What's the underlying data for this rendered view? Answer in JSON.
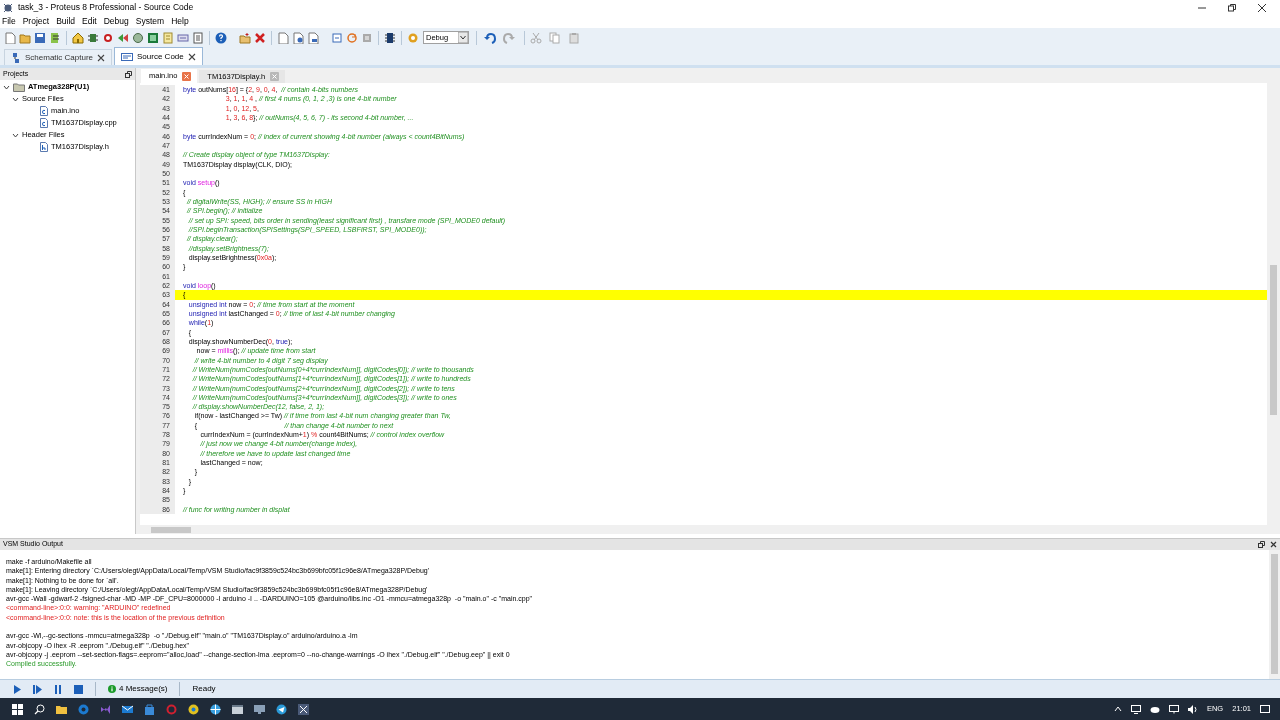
{
  "window": {
    "title": "task_3 - Proteus 8 Professional - Source Code"
  },
  "menu": [
    "File",
    "Project",
    "Build",
    "Edit",
    "Debug",
    "System",
    "Help"
  ],
  "toolbar": {
    "configuration": "Debug"
  },
  "tabs": [
    {
      "label": "Schematic Capture",
      "selected": false
    },
    {
      "label": "Source Code",
      "selected": true
    }
  ],
  "projects": {
    "title": "Projects",
    "tree": [
      {
        "label": "ATmega328P(U1)",
        "kind": "device",
        "expanded": true,
        "children": [
          {
            "label": "Source Files",
            "expanded": true,
            "children": [
              {
                "label": "main.ino",
                "kind": "source"
              },
              {
                "label": "TM1637Display.cpp",
                "kind": "source"
              }
            ]
          },
          {
            "label": "Header Files",
            "expanded": true,
            "children": [
              {
                "label": "TM1637Display.h",
                "kind": "header"
              }
            ]
          }
        ]
      }
    ]
  },
  "editor": {
    "tabs": [
      {
        "label": "main.ino",
        "selected": true
      },
      {
        "label": "TM1637Display.h",
        "selected": false
      }
    ],
    "lines": [
      {
        "number": "41",
        "current": false,
        "tokens": [
          {
            "kind": "keyword",
            "text": "byte"
          },
          {
            "kind": "plain",
            "text": " outNums["
          },
          {
            "kind": "number",
            "text": "16"
          },
          {
            "kind": "plain",
            "text": "] = {"
          },
          {
            "kind": "number",
            "text": "2"
          },
          {
            "kind": "plain",
            "text": ", "
          },
          {
            "kind": "number",
            "text": "9"
          },
          {
            "kind": "plain",
            "text": ", "
          },
          {
            "kind": "number",
            "text": "0"
          },
          {
            "kind": "plain",
            "text": ", "
          },
          {
            "kind": "number",
            "text": "4"
          },
          {
            "kind": "plain",
            "text": ",  "
          },
          {
            "kind": "comment",
            "text": "// contain 4-bits numbers"
          }
        ]
      },
      {
        "number": "42",
        "current": false,
        "tokens": [
          {
            "kind": "number",
            "text": "                      3"
          },
          {
            "kind": "plain",
            "text": ", "
          },
          {
            "kind": "number",
            "text": "1"
          },
          {
            "kind": "plain",
            "text": ", "
          },
          {
            "kind": "number",
            "text": "1"
          },
          {
            "kind": "plain",
            "text": ", "
          },
          {
            "kind": "number",
            "text": "4"
          },
          {
            "kind": "plain",
            "text": " , "
          },
          {
            "kind": "comment",
            "text": "// first 4 nums (0, 1, 2 ,3) is one 4-bit number"
          }
        ]
      },
      {
        "number": "43",
        "current": false,
        "tokens": [
          {
            "kind": "number",
            "text": "                      1"
          },
          {
            "kind": "plain",
            "text": ", "
          },
          {
            "kind": "number",
            "text": "0"
          },
          {
            "kind": "plain",
            "text": ", "
          },
          {
            "kind": "number",
            "text": "12"
          },
          {
            "kind": "plain",
            "text": ", "
          },
          {
            "kind": "number",
            "text": "5"
          },
          {
            "kind": "plain",
            "text": ","
          }
        ]
      },
      {
        "number": "44",
        "current": false,
        "tokens": [
          {
            "kind": "number",
            "text": "                      1"
          },
          {
            "kind": "plain",
            "text": ", "
          },
          {
            "kind": "number",
            "text": "3"
          },
          {
            "kind": "plain",
            "text": ", "
          },
          {
            "kind": "number",
            "text": "6"
          },
          {
            "kind": "plain",
            "text": ", "
          },
          {
            "kind": "number",
            "text": "8"
          },
          {
            "kind": "plain",
            "text": "}; "
          },
          {
            "kind": "comment",
            "text": "// outNums(4, 5, 6, 7) - its second 4-bit number, ..."
          }
        ]
      },
      {
        "number": "45",
        "current": false
      },
      {
        "number": "46",
        "current": false,
        "tokens": [
          {
            "kind": "keyword",
            "text": "byte"
          },
          {
            "kind": "plain",
            "text": " currIndexNum = "
          },
          {
            "kind": "number",
            "text": "0"
          },
          {
            "kind": "plain",
            "text": "; "
          },
          {
            "kind": "comment",
            "text": "// index of current showing 4-bit number (always < count4BitNums)"
          }
        ]
      },
      {
        "number": "47",
        "current": false
      },
      {
        "number": "48",
        "current": false,
        "tokens": [
          {
            "kind": "comment",
            "text": "// Create display object of type TM1637Display:"
          }
        ]
      },
      {
        "number": "49",
        "current": false,
        "tokens": [
          {
            "kind": "plain",
            "text": "TM1637Display display(CLK, DIO);"
          }
        ]
      },
      {
        "number": "50",
        "current": false
      },
      {
        "number": "51",
        "current": false,
        "tokens": [
          {
            "kind": "keyword",
            "text": "void "
          },
          {
            "kind": "function",
            "text": "setup"
          },
          {
            "kind": "plain",
            "text": "()"
          }
        ]
      },
      {
        "number": "52",
        "current": false,
        "tokens": [
          {
            "kind": "plain",
            "text": "{"
          }
        ]
      },
      {
        "number": "53",
        "current": false,
        "tokens": [
          {
            "kind": "comment",
            "text": "  // digitalWrite(SS, HIGH); // ensure SS in HIGH"
          }
        ]
      },
      {
        "number": "54",
        "current": false,
        "tokens": [
          {
            "kind": "comment",
            "text": "  // SPI.begin(); // initialize"
          }
        ]
      },
      {
        "number": "55",
        "current": false,
        "tokens": [
          {
            "kind": "comment",
            "text": "   // set up SPI: speed, bits order in sending(least significant first) , transfare mode (SPI_MODE0 default)"
          }
        ]
      },
      {
        "number": "56",
        "current": false,
        "tokens": [
          {
            "kind": "comment",
            "text": "   //SPI.beginTransaction(SPISettings(SPI_SPEED, LSBFIRST, SPI_MODE0));"
          }
        ]
      },
      {
        "number": "57",
        "current": false,
        "tokens": [
          {
            "kind": "comment",
            "text": "  // display.clear();"
          }
        ]
      },
      {
        "number": "58",
        "current": false,
        "tokens": [
          {
            "kind": "comment",
            "text": "   //display.setBrightness(7);"
          }
        ]
      },
      {
        "number": "59",
        "current": false,
        "tokens": [
          {
            "kind": "plain",
            "text": "   display.setBrightness("
          },
          {
            "kind": "number",
            "text": "0x0a"
          },
          {
            "kind": "plain",
            "text": ");"
          }
        ]
      },
      {
        "number": "60",
        "current": false,
        "tokens": [
          {
            "kind": "plain",
            "text": "}"
          }
        ]
      },
      {
        "number": "61",
        "current": false
      },
      {
        "number": "62",
        "current": false,
        "tokens": [
          {
            "kind": "keyword",
            "text": "void "
          },
          {
            "kind": "function",
            "text": "loop"
          },
          {
            "kind": "plain",
            "text": "()"
          }
        ]
      },
      {
        "number": "63",
        "current": true,
        "tokens": [
          {
            "kind": "plain",
            "text": "{"
          }
        ]
      },
      {
        "number": "64",
        "current": false,
        "tokens": [
          {
            "kind": "keyword",
            "text": "   unsigned int"
          },
          {
            "kind": "plain",
            "text": " now = "
          },
          {
            "kind": "number",
            "text": "0"
          },
          {
            "kind": "plain",
            "text": "; "
          },
          {
            "kind": "comment",
            "text": "// time from start at the moment"
          }
        ]
      },
      {
        "number": "65",
        "current": false,
        "tokens": [
          {
            "kind": "keyword",
            "text": "   unsigned int"
          },
          {
            "kind": "plain",
            "text": " lastChanged = "
          },
          {
            "kind": "number",
            "text": "0"
          },
          {
            "kind": "plain",
            "text": "; "
          },
          {
            "kind": "comment",
            "text": "// time of last 4-bit number changing"
          }
        ]
      },
      {
        "number": "66",
        "current": false,
        "tokens": [
          {
            "kind": "keyword",
            "text": "   while"
          },
          {
            "kind": "plain",
            "text": "("
          },
          {
            "kind": "number",
            "text": "1"
          },
          {
            "kind": "plain",
            "text": ")"
          }
        ]
      },
      {
        "number": "67",
        "current": false,
        "tokens": [
          {
            "kind": "plain",
            "text": "   {"
          }
        ]
      },
      {
        "number": "68",
        "current": false,
        "tokens": [
          {
            "kind": "plain",
            "text": "   display.showNumberDec("
          },
          {
            "kind": "number",
            "text": "0"
          },
          {
            "kind": "plain",
            "text": ", "
          },
          {
            "kind": "keyword",
            "text": "true"
          },
          {
            "kind": "plain",
            "text": ");"
          }
        ]
      },
      {
        "number": "69",
        "current": false,
        "tokens": [
          {
            "kind": "plain",
            "text": "       now = "
          },
          {
            "kind": "function",
            "text": "millis"
          },
          {
            "kind": "plain",
            "text": "(); "
          },
          {
            "kind": "comment",
            "text": "// update time from start"
          }
        ]
      },
      {
        "number": "70",
        "current": false,
        "tokens": [
          {
            "kind": "comment",
            "text": "      // write 4-bit number to 4 digit 7 seg display"
          }
        ]
      },
      {
        "number": "71",
        "current": false,
        "tokens": [
          {
            "kind": "comment",
            "text": "     // WriteNum(numCodes[outNums[0+4*currIndexNum]], digitCodes[0]); // write to thousands"
          }
        ]
      },
      {
        "number": "72",
        "current": false,
        "tokens": [
          {
            "kind": "comment",
            "text": "     // WriteNum(numCodes[outNums[1+4*currIndexNum]], digitCodes[1]); // write to hundreds"
          }
        ]
      },
      {
        "number": "73",
        "current": false,
        "tokens": [
          {
            "kind": "comment",
            "text": "     // WriteNum(numCodes[outNums[2+4*currIndexNum]], digitCodes[2]); // write to tens"
          }
        ]
      },
      {
        "number": "74",
        "current": false,
        "tokens": [
          {
            "kind": "comment",
            "text": "     // WriteNum(numCodes[outNums[3+4*currIndexNum]], digitCodes[3]); // write to ones"
          }
        ]
      },
      {
        "number": "75",
        "current": false,
        "tokens": [
          {
            "kind": "comment",
            "text": "     // display.showNumberDec(12, false, 2, 1);"
          }
        ]
      },
      {
        "number": "76",
        "current": false,
        "tokens": [
          {
            "kind": "plain",
            "text": "      if(now - lastChanged >= Tw) "
          },
          {
            "kind": "comment",
            "text": "// if time from last 4-bit num changing greater than Tw,"
          }
        ]
      },
      {
        "number": "77",
        "current": false,
        "tokens": [
          {
            "kind": "plain",
            "text": "      {                                             "
          },
          {
            "kind": "comment",
            "text": "// than change 4-bit number to next"
          }
        ]
      },
      {
        "number": "78",
        "current": false,
        "tokens": [
          {
            "kind": "plain",
            "text": "         currIndexNum = (currIndexNum+"
          },
          {
            "kind": "number",
            "text": "1"
          },
          {
            "kind": "plain",
            "text": ") "
          },
          {
            "kind": "number",
            "text": "%"
          },
          {
            "kind": "plain",
            "text": " count4BitNums; "
          },
          {
            "kind": "comment",
            "text": "// control index overflow"
          }
        ]
      },
      {
        "number": "79",
        "current": false,
        "tokens": [
          {
            "kind": "comment",
            "text": "         // just now we change 4-bit number(change index),"
          }
        ]
      },
      {
        "number": "80",
        "current": false,
        "tokens": [
          {
            "kind": "comment",
            "text": "         // therefore we have to update last changed time"
          }
        ]
      },
      {
        "number": "81",
        "current": false,
        "tokens": [
          {
            "kind": "plain",
            "text": "         lastChanged = now;"
          }
        ]
      },
      {
        "number": "82",
        "current": false,
        "tokens": [
          {
            "kind": "plain",
            "text": "      }"
          }
        ]
      },
      {
        "number": "83",
        "current": false,
        "tokens": [
          {
            "kind": "plain",
            "text": "   }"
          }
        ]
      },
      {
        "number": "84",
        "current": false,
        "tokens": [
          {
            "kind": "plain",
            "text": "}"
          }
        ]
      },
      {
        "number": "85",
        "current": false
      },
      {
        "number": "86",
        "current": false,
        "tokens": [
          {
            "kind": "comment",
            "text": "// func for writing number in displat"
          }
        ]
      }
    ]
  },
  "output": {
    "title": "VSM Studio Output",
    "groups": [
      {
        "lines": [
          {
            "kind": "normal",
            "text": "make -f arduino/Makefile all"
          },
          {
            "kind": "normal",
            "text": "make[1]: Entering directory `C:/Users/olegt/AppData/Local/Temp/VSM Studio/fac9f3859c524bc3b699bfc05f1c96e8/ATmega328P/Debug'"
          },
          {
            "kind": "normal",
            "text": "make[1]: Nothing to be done for `all'."
          },
          {
            "kind": "normal",
            "text": "make[1]: Leaving directory `C:/Users/olegt/AppData/Local/Temp/VSM Studio/fac9f3859c524bc3b699bfc05f1c96e8/ATmega328P/Debug'"
          },
          {
            "kind": "normal",
            "text": "avr-gcc -Wall -gdwarf-2 -fsigned-char -MD -MP -DF_CPU=8000000 -I arduino -I .. -DARDUINO=105 @arduino/libs.inc -O1 -mmcu=atmega328p  -o \"main.o\" -c \"main.cpp\""
          },
          {
            "kind": "error",
            "text": "<command-line>:0:0: warning: \"ARDUINO\" redefined"
          },
          {
            "kind": "error",
            "text": "<command-line>:0:0: note: this is the location of the previous definition"
          }
        ]
      },
      {
        "lines": [
          {
            "kind": "normal",
            "text": "avr-gcc -Wl,--gc-sections -mmcu=atmega328p  -o \"./Debug.elf\" \"main.o\" \"TM1637Display.o\" arduino/arduino.a -lm"
          },
          {
            "kind": "normal",
            "text": "avr-objcopy -O ihex -R .eeprom \"./Debug.elf\" \"./Debug.hex\""
          },
          {
            "kind": "normal",
            "text": "avr-objcopy -j .eeprom --set-section-flags=.eeprom=\"alloc,load\" --change-section-lma .eeprom=0 --no-change-warnings -O ihex \"./Debug.elf\" \"./Debug.eep\" || exit 0"
          },
          {
            "kind": "success",
            "text": "Compiled successfully."
          }
        ]
      }
    ]
  },
  "status_bar": {
    "messages": "4 Message(s)",
    "state": "Ready"
  },
  "taskbar": {
    "language": "ENG",
    "time": "21:01"
  }
}
